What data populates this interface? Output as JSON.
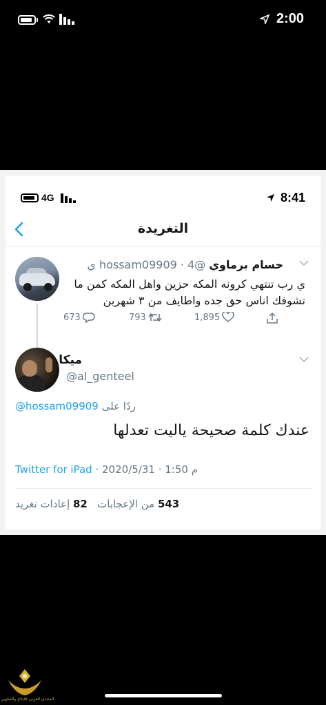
{
  "status_bar": {
    "time": "2:00"
  },
  "inner_status_bar": {
    "network": "4G",
    "time": "8:41"
  },
  "nav": {
    "title": "التغريدة"
  },
  "tweet1": {
    "name": "حسام برماوي",
    "handle": "@hossam09909",
    "time": "4 ي",
    "text": "ي رب تنتهي كرونه المكه حزين واهل المكه كمن ما تشوفك اناس حق جده واطايف من ٣ شهرين",
    "replies": "673",
    "retweets": "793",
    "likes": "1,895"
  },
  "tweet2": {
    "name": "ميكا",
    "handle": "@al_genteel",
    "reply_prefix": "ردًا على",
    "reply_handle": "@hossam09909",
    "text": "عندك كلمة صحيحة ياليت تعدلها",
    "time": "1:50 م",
    "date": "2020/5/31",
    "source": "Twitter for iPad",
    "likes_count": "543",
    "likes_label": "من الإعجابات",
    "retweets_count": "82",
    "retweets_label": "إعادات تغريد"
  },
  "watermark": {
    "text": "المنتدى العربي للإنتاج والتطوير"
  }
}
